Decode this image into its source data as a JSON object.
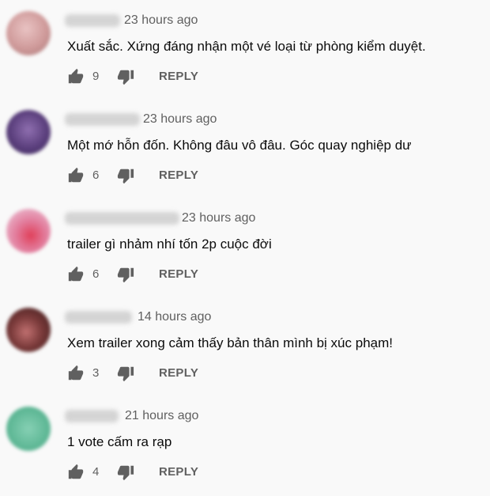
{
  "comments": [
    {
      "time": "23 hours ago",
      "text": "Xuất sắc. Xứng đáng nhận một vé loại từ phòng kiểm duyệt.",
      "likes": "9",
      "reply_label": "REPLY",
      "avatar_color": "#d8a8a8"
    },
    {
      "time": "23 hours ago",
      "text": "Một mớ hỗn đốn. Không đâu vô đâu. Góc quay nghiệp dư",
      "likes": "6",
      "reply_label": "REPLY",
      "avatar_color": "#6a4a8a"
    },
    {
      "time": "23 hours ago",
      "text": "trailer gì nhảm nhí tốn 2p cuộc đời",
      "likes": "6",
      "reply_label": "REPLY",
      "avatar_color": "#d96080"
    },
    {
      "time": "14 hours ago",
      "text": "Xem trailer xong cảm thấy bản thân mình bị xúc phạm!",
      "likes": "3",
      "reply_label": "REPLY",
      "avatar_color": "#5a2a2a"
    },
    {
      "time": "21 hours ago",
      "text": "1 vote cấm ra rạp",
      "likes": "4",
      "reply_label": "REPLY",
      "avatar_color": "#6cbf9e"
    }
  ]
}
